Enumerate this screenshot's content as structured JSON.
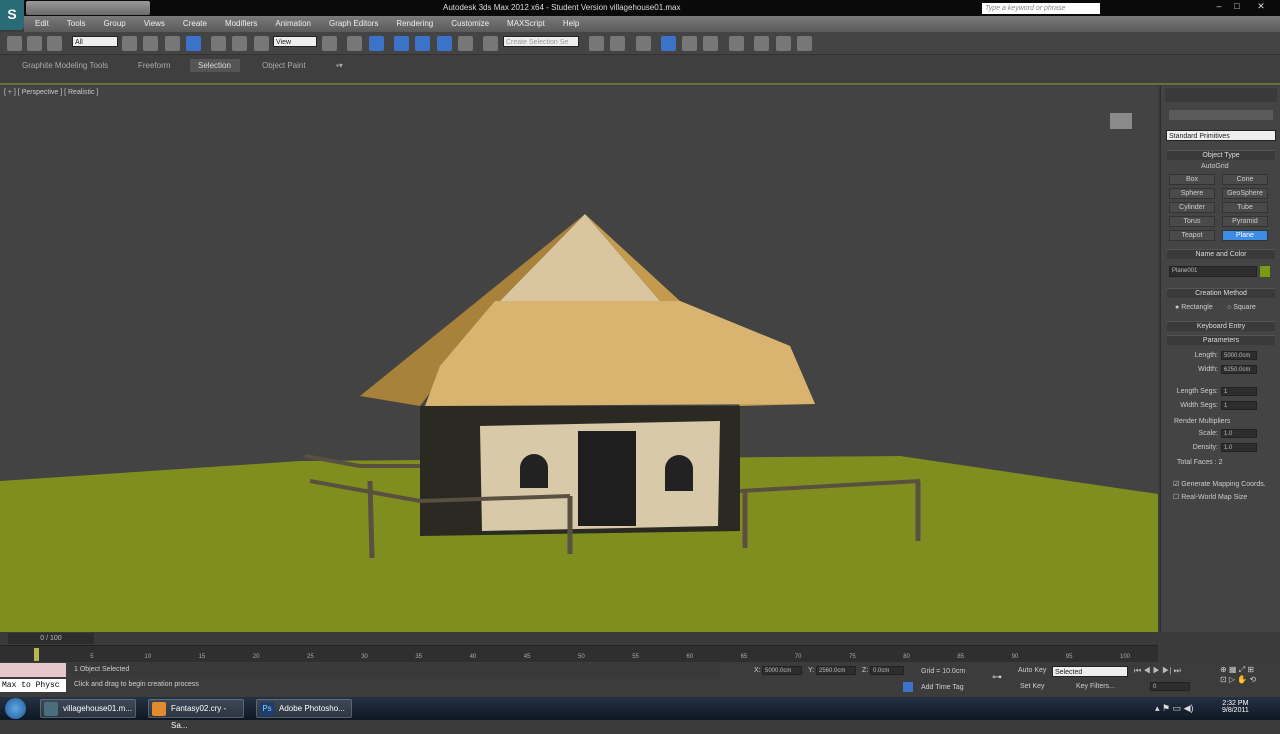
{
  "app": {
    "title": "Autodesk 3ds Max  2012 x64  - Student Version   villagehouse01.max",
    "logo": "S",
    "search_placeholder": "Type a keyword or phrase"
  },
  "menu": [
    "Edit",
    "Tools",
    "Group",
    "Views",
    "Create",
    "Modifiers",
    "Animation",
    "Graph Editors",
    "Rendering",
    "Customize",
    "MAXScript",
    "Help"
  ],
  "toolbar": {
    "selection_filter": "All",
    "ref_coord": "View",
    "named_selection": "Create Selection Se"
  },
  "ribbon": {
    "tabs": [
      "Graphite Modeling Tools",
      "Freeform",
      "Selection",
      "Object Paint"
    ],
    "active": "Selection"
  },
  "viewport": {
    "label": "[ + ] [ Perspective ] [ Realistic ]",
    "colors": {
      "sky": "#434343",
      "ground": "#7f8e1e",
      "roof": "#c9a45a"
    }
  },
  "command_panel": {
    "dropdown": "Standard Primitives",
    "object_type": {
      "title": "Object Type",
      "autogrid": "AutoGrid",
      "buttons": [
        "Box",
        "Cone",
        "Sphere",
        "GeoSphere",
        "Cylinder",
        "Tube",
        "Torus",
        "Pyramid",
        "Teapot",
        "Plane"
      ],
      "active": "Plane"
    },
    "name_color": {
      "title": "Name and Color",
      "name": "Plane001",
      "color": "#7a9a10"
    },
    "creation": {
      "title": "Creation Method",
      "options": [
        "Rectangle",
        "Square"
      ],
      "selected": "Rectangle"
    },
    "keyboard_entry": "Keyboard Entry",
    "parameters": {
      "title": "Parameters",
      "length_label": "Length:",
      "length": "5000.0cm",
      "width_label": "Width:",
      "width": "6250.0cm",
      "lsegs_label": "Length Segs:",
      "lsegs": "1",
      "wsegs_label": "Width Segs:",
      "wsegs": "1",
      "render_mult": "Render Multipliers",
      "scale_label": "Scale:",
      "scale": "1.0",
      "density_label": "Density:",
      "density": "1.0",
      "total_faces": "Total Faces : 2",
      "gen_mapping": "Generate Mapping Coords.",
      "real_world": "Real-World Map Size"
    }
  },
  "timeline": {
    "frame": "0 / 100",
    "ticks": [
      "0",
      "5",
      "10",
      "15",
      "20",
      "25",
      "30",
      "35",
      "40",
      "45",
      "50",
      "55",
      "60",
      "65",
      "70",
      "75",
      "80",
      "85",
      "90",
      "95",
      "100"
    ],
    "progress": 0
  },
  "status": {
    "maxscript": "Max to Physc",
    "selected": "1 Object Selected",
    "prompt": "Click and drag to begin creation process",
    "x_label": "X:",
    "x": "5000.0cm",
    "y_label": "Y:",
    "y": "2560.0cm",
    "z_label": "Z:",
    "z": "0.0cm",
    "grid": "Grid = 10.0cm",
    "add_time_tag": "Add Time Tag",
    "auto_key": "Auto Key",
    "set_key": "Set Key",
    "key_mode": "Selected",
    "key_filters": "Key Filters...",
    "current_frame": "0"
  },
  "taskbar": {
    "items": [
      "villagehouse01.m...",
      "Fantasy02.cry - Sa...",
      "Adobe Photosho..."
    ],
    "time": "2:32 PM",
    "date": "9/8/2011"
  }
}
